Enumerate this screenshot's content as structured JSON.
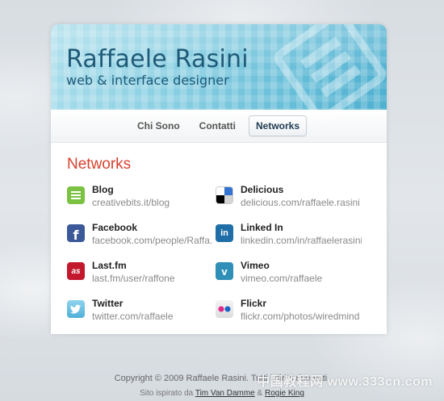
{
  "header": {
    "title": "Raffaele Rasini",
    "subtitle": "web & interface designer"
  },
  "nav": {
    "items": [
      {
        "label": "Chi Sono"
      },
      {
        "label": "Contatti"
      },
      {
        "label": "Networks",
        "active": true
      }
    ]
  },
  "section": {
    "title": "Networks"
  },
  "networks": [
    {
      "name": "Blog",
      "url": "creativebits.it/blog",
      "icon": "blog-icon",
      "color": "#7cc242"
    },
    {
      "name": "Delicious",
      "url": "delicious.com/raffaele.rasini",
      "icon": "delicious-icon",
      "color": "#3274d0"
    },
    {
      "name": "Facebook",
      "url": "facebook.com/people/Raffa...",
      "icon": "facebook-icon",
      "color": "#3b5998"
    },
    {
      "name": "Linked In",
      "url": "linkedin.com/in/raffaelerasini",
      "icon": "linkedin-icon",
      "color": "#1f6ea8"
    },
    {
      "name": "Last.fm",
      "url": "last.fm/user/raffone",
      "icon": "lastfm-icon",
      "color": "#c3172d"
    },
    {
      "name": "Vimeo",
      "url": "vimeo.com/raffaele",
      "icon": "vimeo-icon",
      "color": "#2f8fb6"
    },
    {
      "name": "Twitter",
      "url": "twitter.com/raffaele",
      "icon": "twitter-icon",
      "color": "#5fb8e0"
    },
    {
      "name": "Flickr",
      "url": "flickr.com/photos/wiredmind",
      "icon": "flickr-icon",
      "color": "#e8e8e8"
    }
  ],
  "footer": {
    "copyright": "Copyright © 2009 Raffaele Rasini. Tutti i diritti riservati.",
    "inspired_prefix": "Sito ispirato da",
    "inspired_link1": "Tim Van Damme",
    "inspired_sep": "&",
    "inspired_link2": "Rogie King"
  },
  "watermark": "中国教程网 www.333cn.com"
}
